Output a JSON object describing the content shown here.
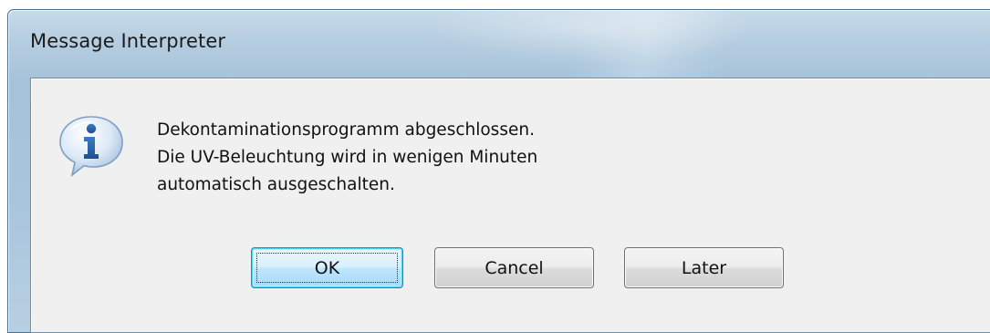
{
  "window": {
    "title": "Message Interpreter"
  },
  "message": {
    "icon": "information-icon",
    "lines": [
      "Dekontaminationsprogramm abgeschlossen.",
      "Die UV-Beleuchtung wird in wenigen Minuten",
      "automatisch ausgeschalten."
    ]
  },
  "buttons": {
    "ok_label": "OK",
    "cancel_label": "Cancel",
    "later_label": "Later",
    "default": "OK"
  },
  "colors": {
    "frame": "#a9c5dc",
    "client_background": "#f0f0f0",
    "default_button_border": "#3c7fb1",
    "icon_blue": "#2b63a8"
  }
}
